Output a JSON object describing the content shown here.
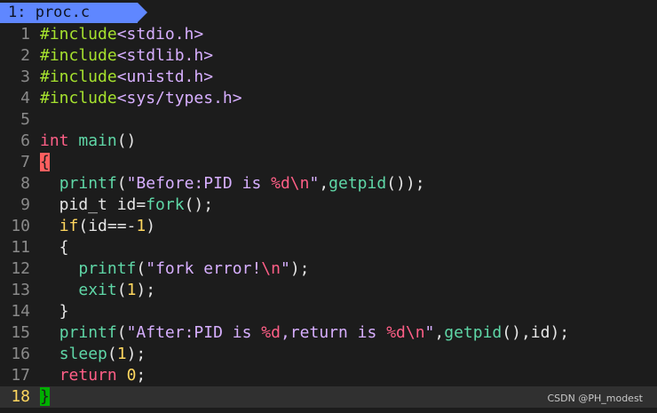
{
  "tabline": {
    "tab_label": "1: proc.c"
  },
  "editor": {
    "current_line": "18",
    "lines": [
      {
        "num": "1",
        "tokens": [
          {
            "t": "#include",
            "c": "t-pre"
          },
          {
            "t": "<stdio.h>",
            "c": "t-str"
          }
        ]
      },
      {
        "num": "2",
        "tokens": [
          {
            "t": "#include",
            "c": "t-pre"
          },
          {
            "t": "<stdlib.h>",
            "c": "t-str"
          }
        ]
      },
      {
        "num": "3",
        "tokens": [
          {
            "t": "#include",
            "c": "t-pre"
          },
          {
            "t": "<unistd.h>",
            "c": "t-str"
          }
        ]
      },
      {
        "num": "4",
        "tokens": [
          {
            "t": "#include",
            "c": "t-pre"
          },
          {
            "t": "<sys/types.h>",
            "c": "t-str"
          }
        ]
      },
      {
        "num": "5",
        "tokens": []
      },
      {
        "num": "6",
        "tokens": [
          {
            "t": "int",
            "c": "t-type"
          },
          {
            "t": " ",
            "c": "t-id"
          },
          {
            "t": "main",
            "c": "t-fn"
          },
          {
            "t": "()",
            "c": "t-id"
          }
        ]
      },
      {
        "num": "7",
        "tokens": [
          {
            "t": "{",
            "c": "t-brace-match"
          }
        ]
      },
      {
        "num": "8",
        "tokens": [
          {
            "t": "  ",
            "c": "t-id"
          },
          {
            "t": "printf",
            "c": "t-fn"
          },
          {
            "t": "(",
            "c": "t-id"
          },
          {
            "t": "\"Before:PID is ",
            "c": "t-str"
          },
          {
            "t": "%d\\n",
            "c": "t-esc"
          },
          {
            "t": "\"",
            "c": "t-str"
          },
          {
            "t": ",",
            "c": "t-id"
          },
          {
            "t": "getpid",
            "c": "t-fn"
          },
          {
            "t": "());",
            "c": "t-id"
          }
        ]
      },
      {
        "num": "9",
        "tokens": [
          {
            "t": "  pid_t id=",
            "c": "t-id"
          },
          {
            "t": "fork",
            "c": "t-fn"
          },
          {
            "t": "();",
            "c": "t-id"
          }
        ]
      },
      {
        "num": "10",
        "tokens": [
          {
            "t": "  ",
            "c": "t-id"
          },
          {
            "t": "if",
            "c": "t-kw"
          },
          {
            "t": "(id==-",
            "c": "t-id"
          },
          {
            "t": "1",
            "c": "t-num"
          },
          {
            "t": ")",
            "c": "t-id"
          }
        ]
      },
      {
        "num": "11",
        "tokens": [
          {
            "t": "  {",
            "c": "t-id"
          }
        ]
      },
      {
        "num": "12",
        "tokens": [
          {
            "t": "    ",
            "c": "t-id"
          },
          {
            "t": "printf",
            "c": "t-fn"
          },
          {
            "t": "(",
            "c": "t-id"
          },
          {
            "t": "\"fork error!",
            "c": "t-str"
          },
          {
            "t": "\\n",
            "c": "t-esc"
          },
          {
            "t": "\"",
            "c": "t-str"
          },
          {
            "t": ");",
            "c": "t-id"
          }
        ]
      },
      {
        "num": "13",
        "tokens": [
          {
            "t": "    ",
            "c": "t-id"
          },
          {
            "t": "exit",
            "c": "t-fn"
          },
          {
            "t": "(",
            "c": "t-id"
          },
          {
            "t": "1",
            "c": "t-num"
          },
          {
            "t": ");",
            "c": "t-id"
          }
        ]
      },
      {
        "num": "14",
        "tokens": [
          {
            "t": "  }",
            "c": "t-id"
          }
        ]
      },
      {
        "num": "15",
        "tokens": [
          {
            "t": "  ",
            "c": "t-id"
          },
          {
            "t": "printf",
            "c": "t-fn"
          },
          {
            "t": "(",
            "c": "t-id"
          },
          {
            "t": "\"After:PID is ",
            "c": "t-str"
          },
          {
            "t": "%d",
            "c": "t-esc"
          },
          {
            "t": ",return is ",
            "c": "t-str"
          },
          {
            "t": "%d\\n",
            "c": "t-esc"
          },
          {
            "t": "\"",
            "c": "t-str"
          },
          {
            "t": ",",
            "c": "t-id"
          },
          {
            "t": "getpid",
            "c": "t-fn"
          },
          {
            "t": "(),id);",
            "c": "t-id"
          }
        ]
      },
      {
        "num": "16",
        "tokens": [
          {
            "t": "  ",
            "c": "t-id"
          },
          {
            "t": "sleep",
            "c": "t-fn"
          },
          {
            "t": "(",
            "c": "t-id"
          },
          {
            "t": "1",
            "c": "t-num"
          },
          {
            "t": ");",
            "c": "t-id"
          }
        ]
      },
      {
        "num": "17",
        "tokens": [
          {
            "t": "  ",
            "c": "t-id"
          },
          {
            "t": "return",
            "c": "t-ret"
          },
          {
            "t": " ",
            "c": "t-id"
          },
          {
            "t": "0",
            "c": "t-num"
          },
          {
            "t": ";",
            "c": "t-id"
          }
        ]
      },
      {
        "num": "18",
        "tokens": [
          {
            "t": "}",
            "c": "t-brace-cursor"
          }
        ]
      }
    ]
  },
  "watermark": {
    "text": "CSDN @PH_modest"
  },
  "colors": {
    "background": "#1c1c1c",
    "tab": "#5f87ff",
    "preprocessor": "#a6e22e",
    "string": "#d7afff",
    "keyword_type": "#ff5f87",
    "function": "#5fd7a7",
    "number": "#ffd75f",
    "line_number": "#8a8a8a",
    "cursor_line_number": "#ffd75f",
    "matching_brace": "#ff5f5f",
    "cursor": "#00af00"
  }
}
